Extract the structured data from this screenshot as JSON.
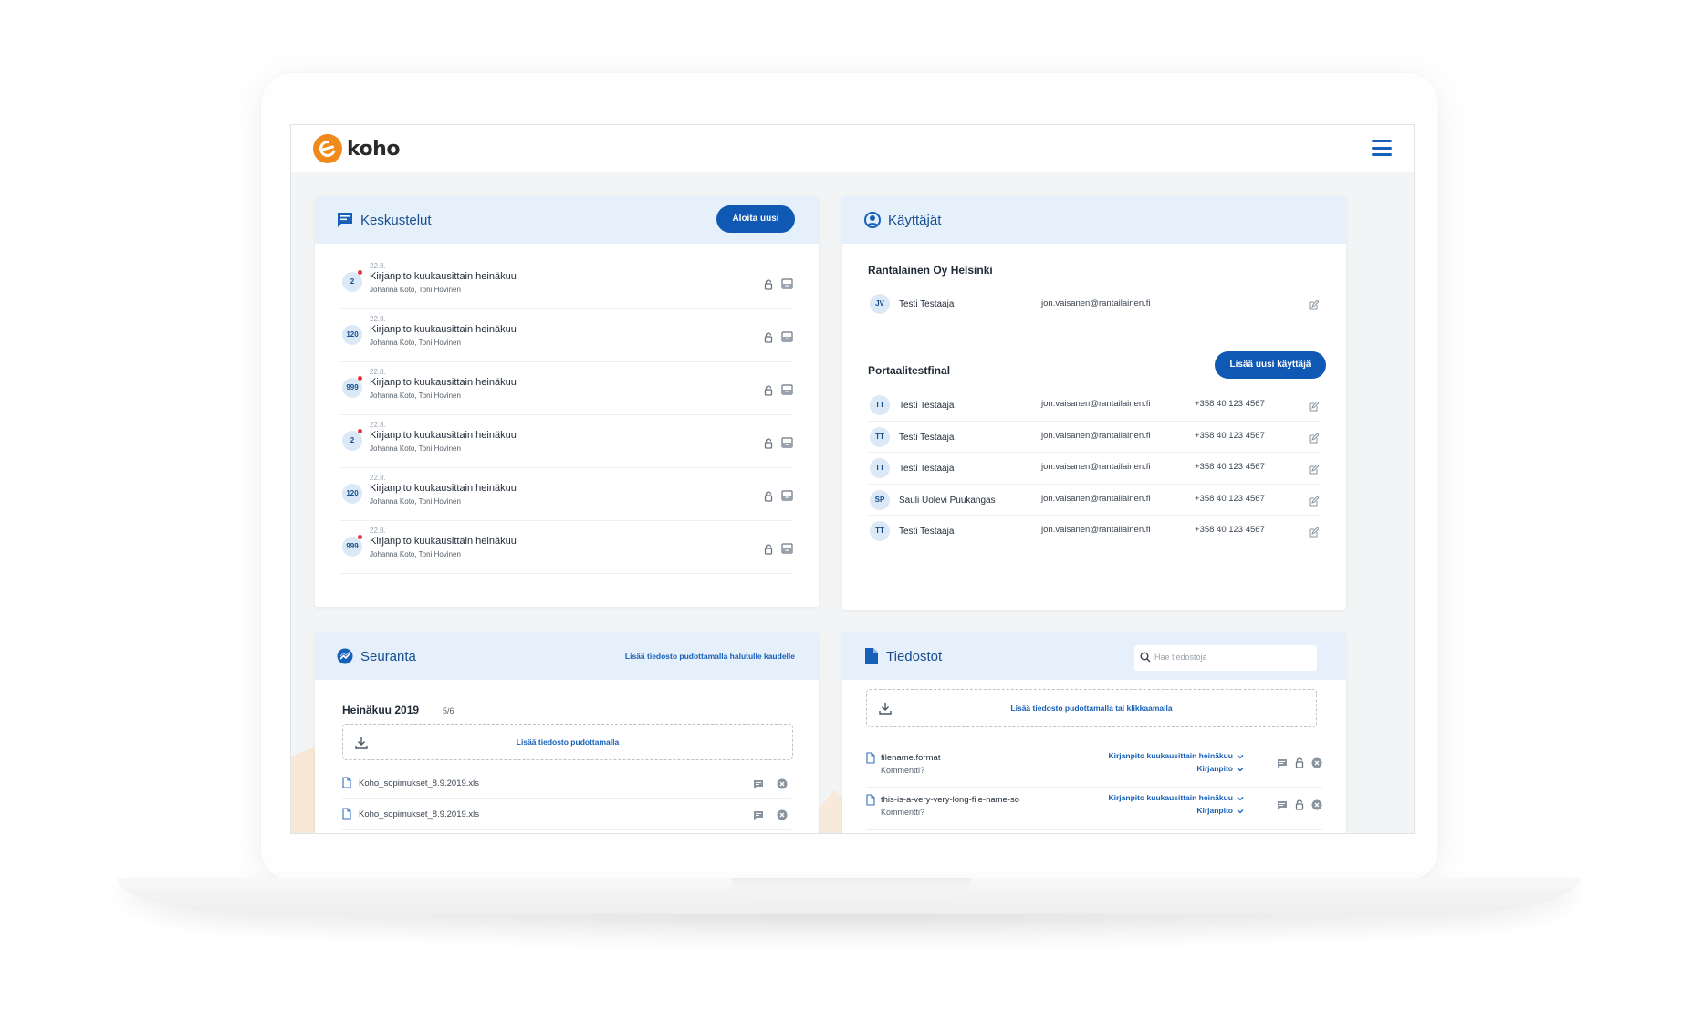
{
  "brand": {
    "name": "koho",
    "accent": "#f08a1c",
    "primary": "#0f58b4"
  },
  "conversations": {
    "title": "Keskustelut",
    "new_button": "Aloita uusi",
    "items": [
      {
        "badge": "2",
        "unread": true,
        "date": "22.8.",
        "title": "Kirjanpito kuukausittain heinäkuu",
        "people": "Johanna Koto, Toni Hovinen"
      },
      {
        "badge": "120",
        "unread": false,
        "date": "22.8.",
        "title": "Kirjanpito kuukausittain heinäkuu",
        "people": "Johanna Koto, Toni Hovinen"
      },
      {
        "badge": "999",
        "unread": true,
        "date": "22.8.",
        "title": "Kirjanpito kuukausittain heinäkuu",
        "people": "Johanna Koto, Toni Hovinen"
      },
      {
        "badge": "2",
        "unread": true,
        "date": "22.8.",
        "title": "Kirjanpito kuukausittain heinäkuu",
        "people": "Johanna Koto, Toni Hovinen"
      },
      {
        "badge": "120",
        "unread": false,
        "date": "22.8.",
        "title": "Kirjanpito kuukausittain heinäkuu",
        "people": "Johanna Koto, Toni Hovinen"
      },
      {
        "badge": "999",
        "unread": true,
        "date": "22.8.",
        "title": "Kirjanpito kuukausittain heinäkuu",
        "people": "Johanna Koto, Toni Hovinen"
      }
    ]
  },
  "users": {
    "title": "Käyttäjät",
    "add_button": "Lisää uusi käyttäjä",
    "groups": [
      {
        "name": "Rantalainen Oy Helsinki",
        "members": [
          {
            "initials": "JV",
            "name": "Testi Testaaja",
            "email": "jon.vaisanen@rantailainen.fi",
            "phone": ""
          }
        ]
      },
      {
        "name": "Portaalitestfinal",
        "members": [
          {
            "initials": "TT",
            "name": "Testi Testaaja",
            "email": "jon.vaisanen@rantailainen.fi",
            "phone": "+358 40 123 4567"
          },
          {
            "initials": "TT",
            "name": "Testi Testaaja",
            "email": "jon.vaisanen@rantailainen.fi",
            "phone": "+358 40 123 4567"
          },
          {
            "initials": "TT",
            "name": "Testi Testaaja",
            "email": "jon.vaisanen@rantailainen.fi",
            "phone": "+358 40 123 4567"
          },
          {
            "initials": "SP",
            "name": "Sauli  Uolevi Puukangas",
            "email": "jon.vaisanen@rantailainen.fi",
            "phone": "+358 40 123 4567"
          },
          {
            "initials": "TT",
            "name": "Testi Testaaja",
            "email": "jon.vaisanen@rantailainen.fi",
            "phone": "+358 40 123 4567"
          }
        ]
      }
    ]
  },
  "tracking": {
    "title": "Seuranta",
    "header_link": "Lisää tiedosto pudottamalla halutulle kaudelle",
    "period": "Heinäkuu 2019",
    "period_count": "5/6",
    "dropzone": "Lisää tiedosto pudottamalla",
    "files": [
      "Koho_sopimukset_8.9.2019.xls",
      "Koho_sopimukset_8.9.2019.xls"
    ]
  },
  "files": {
    "title": "Tiedostot",
    "search_placeholder": "Hae tiedostoja",
    "dropzone": "Lisää tiedosto pudottamalla tai klikkaamalla",
    "items": [
      {
        "name": "filename.format",
        "comment": "Kommentti?",
        "category": "Kirjanpito kuukausittain heinäkuu",
        "type": "Kirjanpito"
      },
      {
        "name": "this-is-a-very-very-long-file-name-so",
        "comment": "Kommentti?",
        "category": "Kirjanpito kuukausittain heinäkuu",
        "type": "Kirjanpito"
      }
    ]
  }
}
